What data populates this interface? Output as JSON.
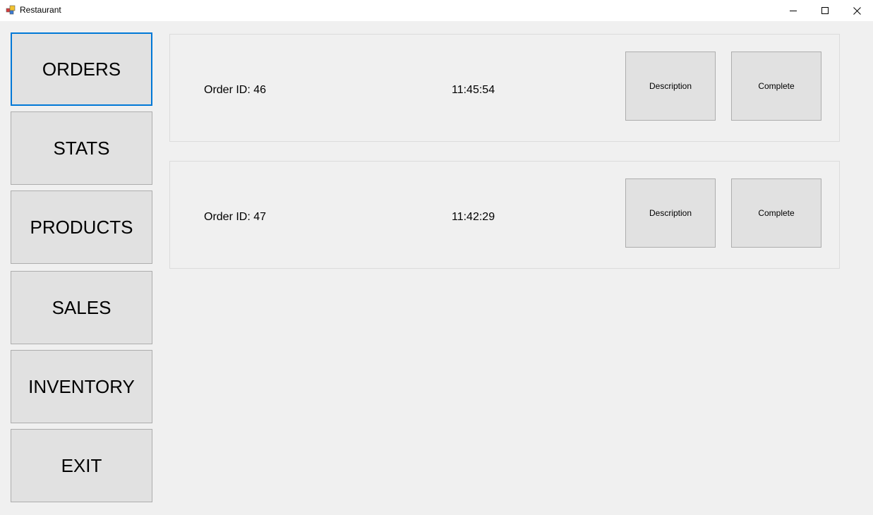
{
  "window": {
    "title": "Restaurant",
    "minimize_icon": "minimize-icon",
    "maximize_icon": "maximize-icon",
    "close_icon": "close-icon"
  },
  "nav": {
    "items": [
      {
        "label": "ORDERS",
        "active": true
      },
      {
        "label": "STATS",
        "active": false
      },
      {
        "label": "PRODUCTS",
        "active": false
      },
      {
        "label": "SALES",
        "active": false
      },
      {
        "label": "INVENTORY",
        "active": false
      },
      {
        "label": "EXIT",
        "active": false
      }
    ]
  },
  "orders": [
    {
      "id_text": "Order ID: 46",
      "time": "11:45:54",
      "description_label": "Description",
      "complete_label": "Complete"
    },
    {
      "id_text": "Order ID: 47",
      "time": "11:42:29",
      "description_label": "Description",
      "complete_label": "Complete"
    }
  ],
  "colors": {
    "accent": "#0078d7",
    "button_bg": "#e1e1e1",
    "window_bg": "#f0f0f0"
  }
}
